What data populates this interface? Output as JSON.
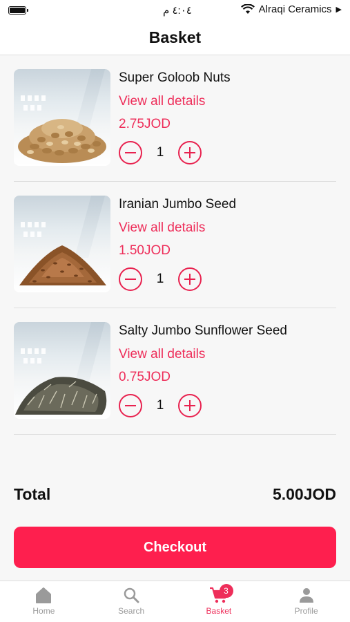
{
  "status_bar": {
    "time": "٤:٠٤ م",
    "carrier": "Alraqi Ceramics"
  },
  "header": {
    "title": "Basket"
  },
  "items": [
    {
      "name": "Super Goloob Nuts",
      "details_link": "View all details",
      "price": "2.75JOD",
      "quantity": "1",
      "image": "mixed-nuts-pile"
    },
    {
      "name": "Iranian Jumbo Seed",
      "details_link": "View all details",
      "price": "1.50JOD",
      "quantity": "1",
      "image": "brown-seeds-pile"
    },
    {
      "name": "Salty Jumbo Sunflower Seed",
      "details_link": "View all details",
      "price": "0.75JOD",
      "quantity": "1",
      "image": "sunflower-seeds-pile"
    }
  ],
  "total": {
    "label": "Total",
    "value": "5.00JOD"
  },
  "checkout_label": "Checkout",
  "tabs": [
    {
      "label": "Home",
      "icon": "home-icon"
    },
    {
      "label": "Search",
      "icon": "search-icon"
    },
    {
      "label": "Basket",
      "icon": "cart-icon",
      "badge": "3",
      "active": true
    },
    {
      "label": "Profile",
      "icon": "profile-icon"
    }
  ],
  "colors": {
    "accent": "#ee2e5a",
    "checkout_bg": "#fe1f4e",
    "tab_inactive": "#9a9a9a"
  }
}
